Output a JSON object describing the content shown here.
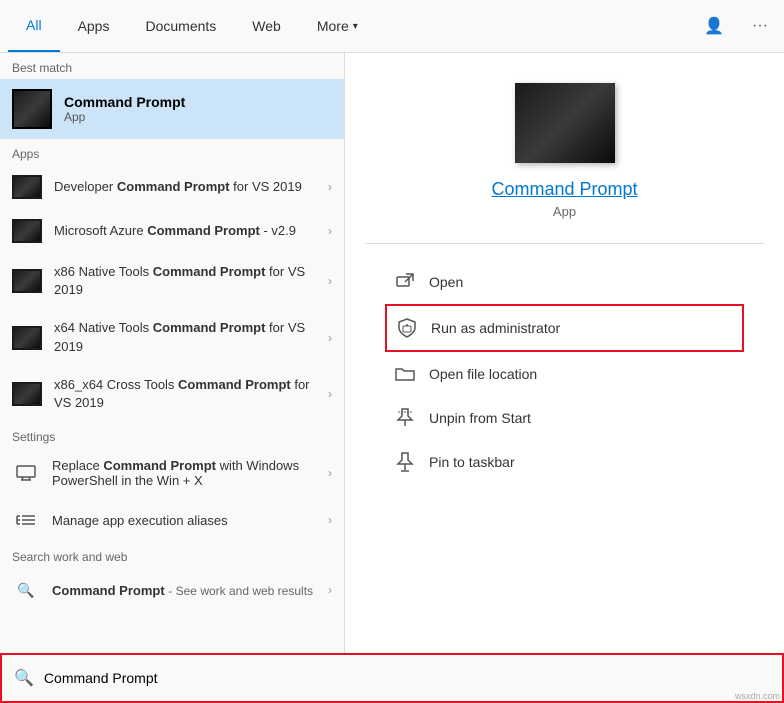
{
  "nav": {
    "tabs": [
      {
        "label": "All",
        "active": true
      },
      {
        "label": "Apps",
        "active": false
      },
      {
        "label": "Documents",
        "active": false
      },
      {
        "label": "Web",
        "active": false
      },
      {
        "label": "More",
        "active": false,
        "hasChevron": true
      }
    ],
    "right_icons": [
      "person-icon",
      "more-icon"
    ]
  },
  "left": {
    "best_match_label": "Best match",
    "best_match": {
      "title": "Command Prompt",
      "subtitle": "App"
    },
    "apps_label": "Apps",
    "apps": [
      {
        "text_before": "Developer ",
        "bold": "Command Prompt",
        "text_after": " for VS 2019"
      },
      {
        "text_before": "Microsoft Azure ",
        "bold": "Command Prompt",
        "text_after": " - v2.9"
      },
      {
        "text_before": "x86 Native Tools ",
        "bold": "Command Prompt",
        "text_after": " for VS 2019"
      },
      {
        "text_before": "x64 Native Tools ",
        "bold": "Command Prompt",
        "text_after": " for VS 2019"
      },
      {
        "text_before": "x86_x64 Cross Tools ",
        "bold": "Command Prompt",
        "text_after": " for VS 2019"
      }
    ],
    "settings_label": "Settings",
    "settings": [
      {
        "text_before": "Replace ",
        "bold": "Command Prompt",
        "text_after": " with Windows PowerShell in the Win + X"
      },
      {
        "text_before": "Manage app execution aliases",
        "bold": "",
        "text_after": ""
      }
    ],
    "web_label": "Search work and web",
    "web": [
      {
        "bold": "Command Prompt",
        "suffix": " - See work and web results"
      }
    ]
  },
  "right": {
    "app_title": "Command Prompt",
    "app_subtitle": "App",
    "actions": [
      {
        "label": "Open",
        "icon": "open-icon",
        "highlighted": false
      },
      {
        "label": "Run as administrator",
        "icon": "shield-icon",
        "highlighted": true
      },
      {
        "label": "Open file location",
        "icon": "folder-icon",
        "highlighted": false
      },
      {
        "label": "Unpin from Start",
        "icon": "unpin-icon",
        "highlighted": false
      },
      {
        "label": "Pin to taskbar",
        "icon": "pin-taskbar-icon",
        "highlighted": false
      }
    ]
  },
  "search": {
    "value": "Command Prompt",
    "placeholder": "Command Prompt"
  },
  "watermark": "wsxdn.com"
}
